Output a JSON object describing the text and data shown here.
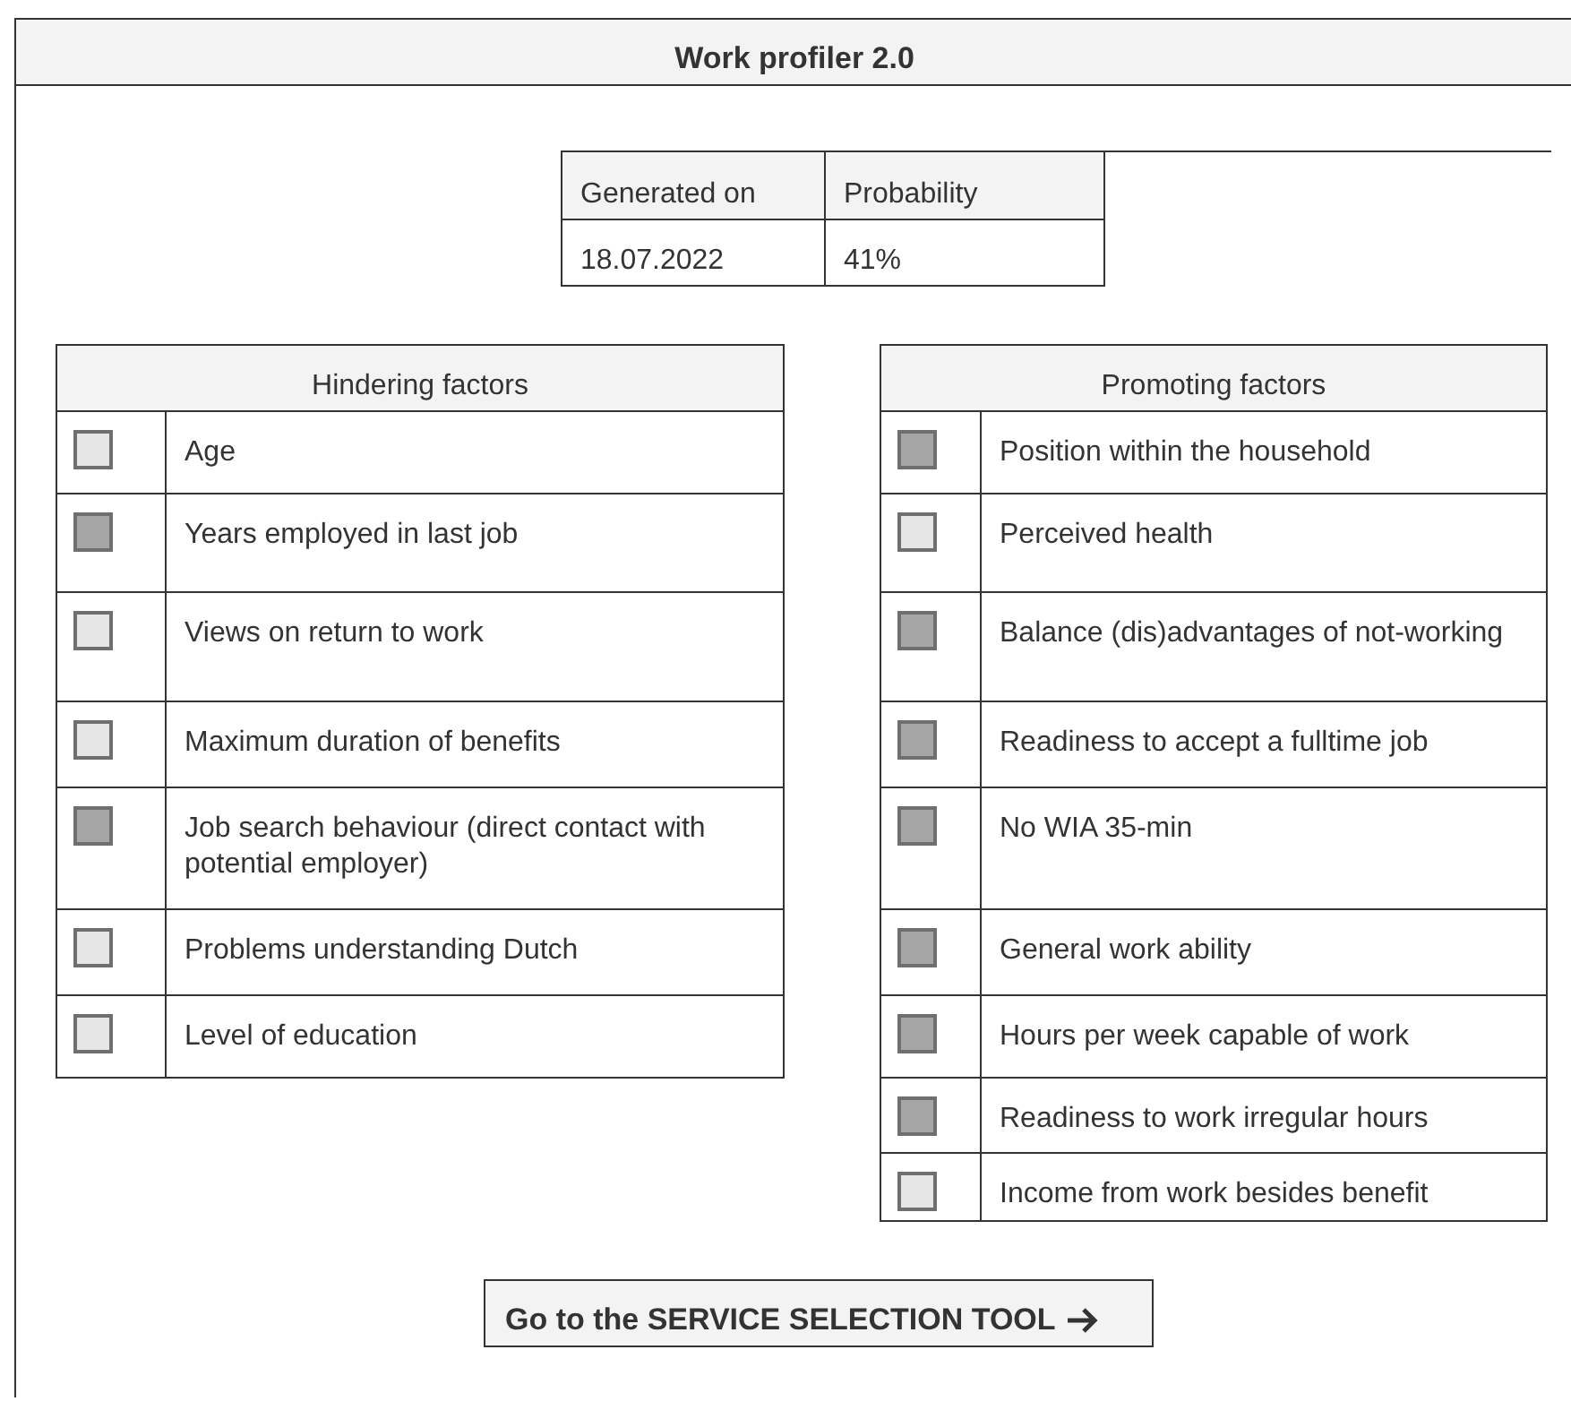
{
  "window": {
    "title": "Work profiler 2.0"
  },
  "summary": {
    "columns": [
      "Generated on",
      "Probability"
    ],
    "values": [
      "18.07.2022",
      "41%"
    ]
  },
  "hindering_factors": {
    "title": "Hindering factors",
    "items": [
      {
        "label": "Age",
        "checked": false
      },
      {
        "label": "Years employed in last job",
        "checked": true
      },
      {
        "label": "Views on return to work",
        "checked": false
      },
      {
        "label": "Maximum duration of benefits",
        "checked": false
      },
      {
        "label": "Job search behaviour (direct contact with potential employer)",
        "checked": true
      },
      {
        "label": "Problems understanding Dutch",
        "checked": false
      },
      {
        "label": "Level of education",
        "checked": false
      }
    ]
  },
  "promoting_factors": {
    "title": "Promoting factors",
    "items": [
      {
        "label": "Position within the household",
        "checked": true
      },
      {
        "label": "Perceived health",
        "checked": false
      },
      {
        "label": "Balance (dis)advantages of not-working",
        "checked": true
      },
      {
        "label": "Readiness to accept a fulltime job",
        "checked": true
      },
      {
        "label": "No WIA 35-min",
        "checked": true
      },
      {
        "label": "General work ability",
        "checked": true
      },
      {
        "label": "Hours per week capable of work",
        "checked": true
      },
      {
        "label": "Readiness to work irregular hours",
        "checked": true
      },
      {
        "label": "Income from work besides benefit",
        "checked": false
      }
    ]
  },
  "action_button": {
    "label": "Go to the SERVICE SELECTION TOOL"
  }
}
